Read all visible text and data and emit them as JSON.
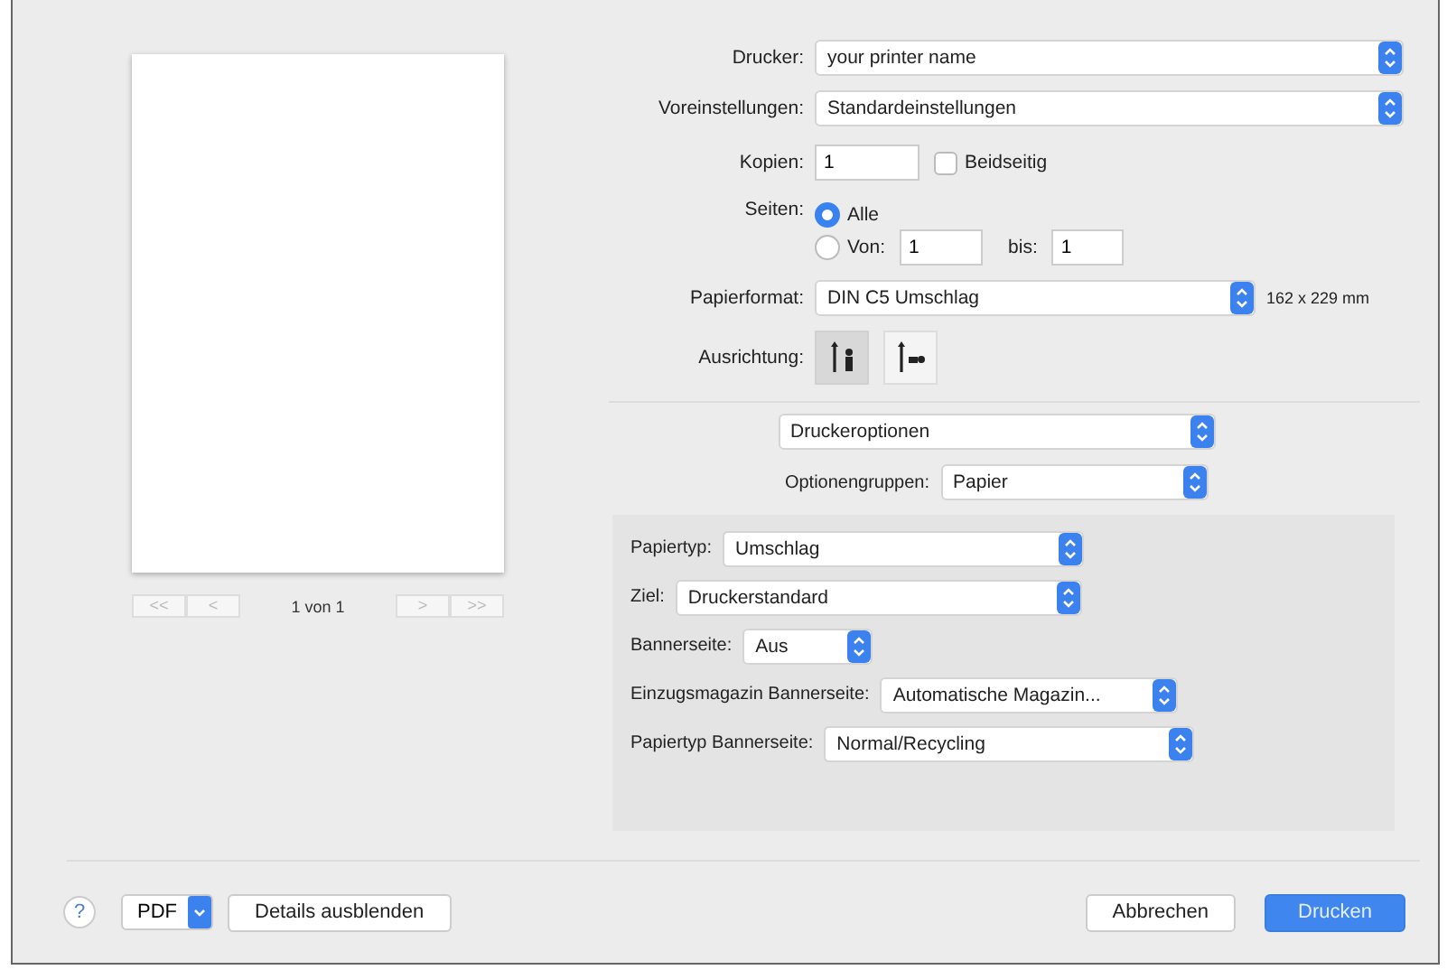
{
  "preview": {
    "page_indicator": "1 von 1",
    "nav_buttons": [
      {
        "label": "<<",
        "disabled": true
      },
      {
        "label": "<",
        "disabled": true
      },
      {
        "label": ">",
        "disabled": true
      },
      {
        "label": ">>",
        "disabled": true
      }
    ]
  },
  "printer": {
    "label": "Drucker:",
    "value": "your printer name"
  },
  "presets": {
    "label": "Voreinstellungen:",
    "value": "Standardeinstellungen"
  },
  "copies": {
    "label": "Kopien:",
    "value": "1",
    "duplex": {
      "label": "Beidseitig",
      "checked": false
    }
  },
  "pages": {
    "label": "Seiten:",
    "options": [
      {
        "label": "Alle",
        "selected": true
      },
      {
        "label": "Von:",
        "selected": false
      }
    ],
    "from": "1",
    "to_label": "bis:",
    "to": "1"
  },
  "paper_size": {
    "label": "Papierformat:",
    "value": "DIN C5 Umschlag",
    "dimensions": "162 x 229 mm"
  },
  "orientation": {
    "label": "Ausrichtung:",
    "options": [
      {
        "kind": "portrait",
        "selected": true
      },
      {
        "kind": "landscape",
        "selected": false
      }
    ]
  },
  "section_popup": {
    "value": "Druckeroptionen"
  },
  "option_groups": {
    "label": "Optionengruppen:",
    "value": "Papier"
  },
  "options": [
    {
      "label": "Papiertyp:",
      "value": "Umschlag"
    },
    {
      "label": "Ziel:",
      "value": "Druckerstandard"
    },
    {
      "label": "Bannerseite:",
      "value": "Aus"
    },
    {
      "label": "Einzugsmagazin Bannerseite:",
      "value": "Automatische Magazin..."
    },
    {
      "label": "Papiertyp Bannerseite:",
      "value": "Normal/Recycling"
    }
  ],
  "footer": {
    "help": "?",
    "pdf": "PDF",
    "details": "Details ausblenden",
    "cancel": "Abbrechen",
    "print": "Drucken"
  }
}
